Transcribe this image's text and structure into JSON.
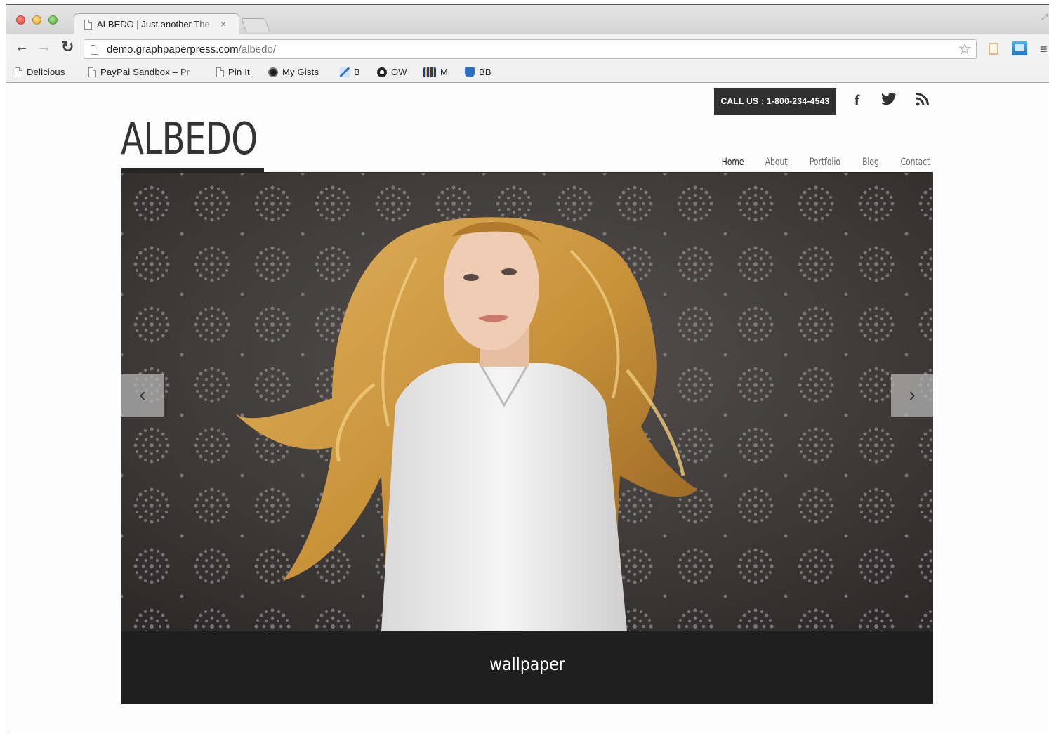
{
  "browser": {
    "tab_title": "ALBEDO | Just another The",
    "tab_close": "×",
    "url_host": "demo.graphpaperpress.com",
    "url_path": "/albedo/",
    "bookmarks": [
      {
        "label": "Delicious",
        "icon": "document-icon"
      },
      {
        "label": "PayPal Sandbox – Pr",
        "icon": "document-icon"
      },
      {
        "label": "Pin It",
        "icon": "document-icon"
      },
      {
        "label": "My Gists",
        "icon": "github-icon"
      },
      {
        "label": "B",
        "icon": "chart-icon"
      },
      {
        "label": "OW",
        "icon": "ow-icon"
      },
      {
        "label": "M",
        "icon": "bars-icon"
      },
      {
        "label": "BB",
        "icon": "cup-icon"
      }
    ]
  },
  "site": {
    "call_us": "CALL US : 1-800-234-4543",
    "social": [
      "facebook-icon",
      "twitter-icon",
      "rss-icon"
    ],
    "logo": "ALBEDO",
    "nav": [
      {
        "label": "Home",
        "active": true
      },
      {
        "label": "About"
      },
      {
        "label": "Portfolio"
      },
      {
        "label": "Blog"
      },
      {
        "label": "Contact"
      }
    ],
    "slide_caption": "wallpaper",
    "prev_arrow": "‹",
    "next_arrow": "›"
  },
  "colors": {
    "call_bg": "#303030",
    "caption_bg": "#1f1f1f",
    "wallpaper": "#3a3736",
    "hair": "#c8923a"
  }
}
